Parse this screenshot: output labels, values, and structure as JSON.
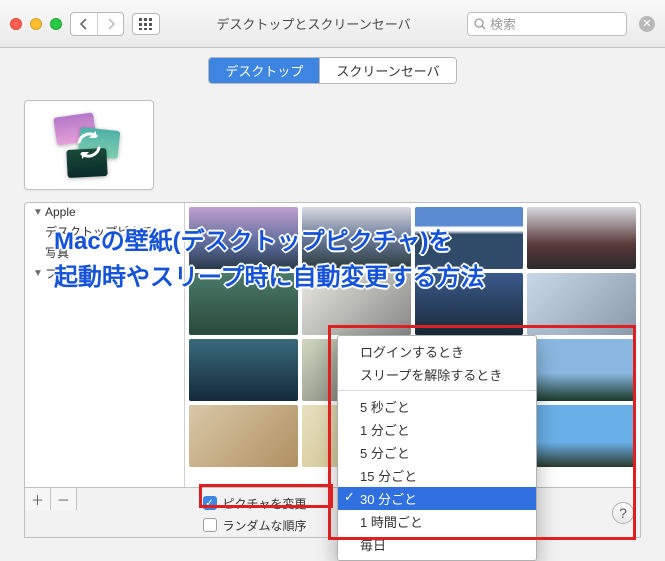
{
  "window": {
    "title": "デスクトップとスクリーンセーバ"
  },
  "search": {
    "placeholder": "検索"
  },
  "tabs": {
    "desktop": "デスクトップ",
    "screensaver": "スクリーンセーバ"
  },
  "sidebar": {
    "group_apple": "Apple",
    "item_desktop_pics": "デスクトップピクチャ",
    "item_photos": "写真",
    "group_folders": "フォルダ"
  },
  "controls": {
    "change_picture": "ピクチャを変更",
    "random_order": "ランダムな順序"
  },
  "interval_menu": {
    "on_login": "ログインするとき",
    "on_wake": "スリープを解除するとき",
    "every_5s": "5 秒ごと",
    "every_1m": "1 分ごと",
    "every_5m": "5 分ごと",
    "every_15m": "15 分ごと",
    "every_30m": "30 分ごと",
    "every_1h": "1 時間ごと",
    "every_day": "毎日"
  },
  "annotation": {
    "line1": "Macの壁紙(デスクトップピクチャ)を",
    "line2": "起動時やスリープ時に自動変更する方法"
  }
}
